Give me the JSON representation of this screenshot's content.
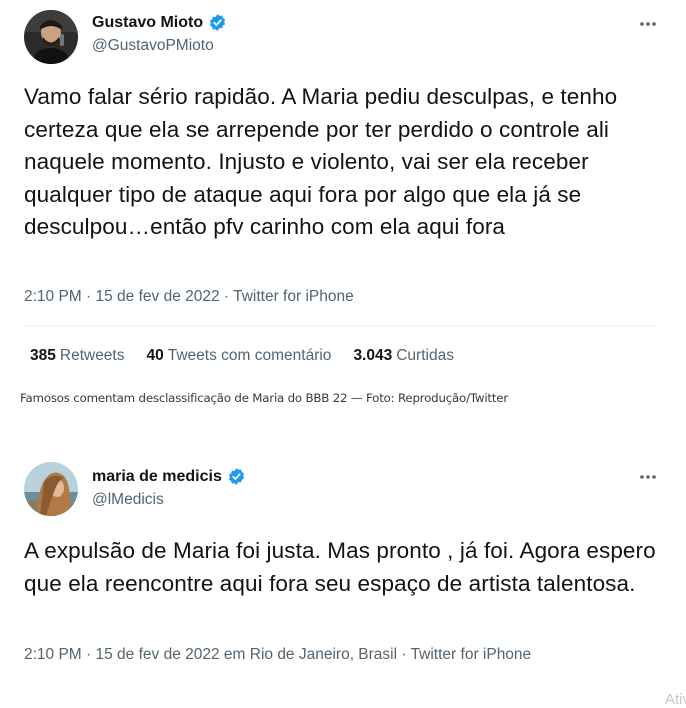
{
  "tweets": [
    {
      "display_name": "Gustavo Mioto",
      "handle": "@GustavoPMioto",
      "verified": true,
      "text": "Vamo falar sério rapidão. A Maria pediu desculpas, e tenho certeza que ela se arrepende por ter perdido o controle ali naquele momento. Injusto e violento, vai ser ela receber qualquer tipo de ataque aqui fora por algo que ela já se desculpou…então pfv carinho com ela aqui fora",
      "meta": "2:10 PM · 15 de fev de 2022 · Twitter for iPhone",
      "stats": {
        "retweets_count": "385",
        "retweets_label": "Retweets",
        "quotes_count": "40",
        "quotes_label": "Tweets com comentário",
        "likes_count": "3.043",
        "likes_label": "Curtidas"
      }
    },
    {
      "display_name": "maria de medicis",
      "handle": "@lMedicis",
      "verified": true,
      "text": "A expulsão de Maria foi justa. Mas pronto , já foi. Agora espero que ela reencontre aqui fora seu espaço de artista talentosa.",
      "meta": "2:10 PM · 15 de fev de 2022 em Rio de Janeiro, Brasil · Twitter for iPhone"
    }
  ],
  "caption": "Famosos comentam desclassificação de Maria do BBB 22 — Foto: Reprodução/Twitter",
  "watermark": "Ativ",
  "colors": {
    "verified": "#1d9bf0",
    "secondary_text": "#536471",
    "primary_text": "#0f1419"
  },
  "icons": [
    "verified-badge-icon",
    "more-options-icon"
  ]
}
